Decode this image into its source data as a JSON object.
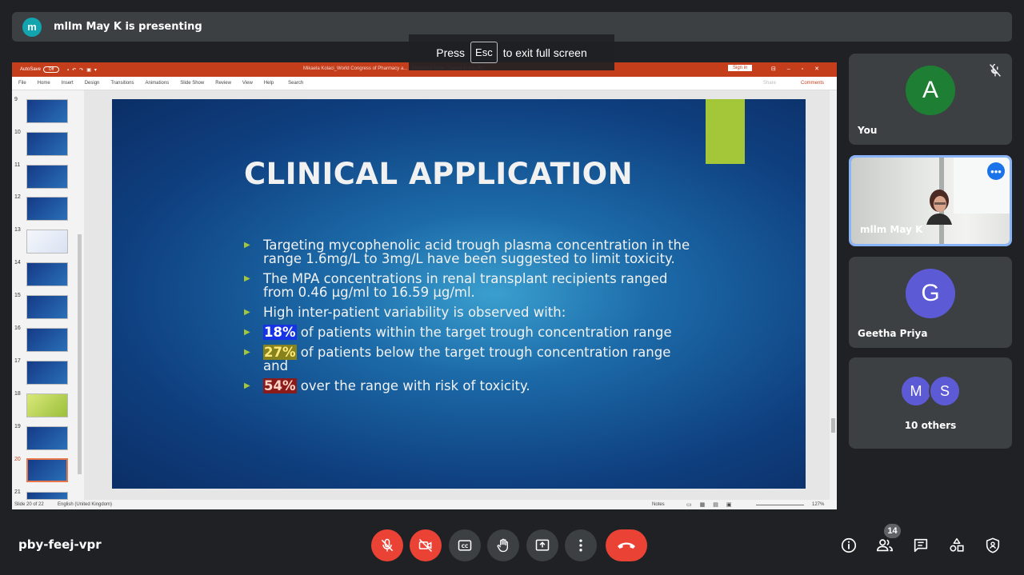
{
  "presenter_banner": {
    "avatar_letter": "m",
    "text": "mllm May K is presenting"
  },
  "fullscreen_toast": {
    "before": "Press",
    "key": "Esc",
    "after": "to exit full screen"
  },
  "ppt": {
    "autosave_label": "AutoSave",
    "autosave_state": "Off",
    "document_title": "Mikaela Kolaci_World Congress of  Pharmacy a...  ·  Protected View  ·  Saved to this PC",
    "signin_label": "Sign in",
    "menu": [
      "File",
      "Home",
      "Insert",
      "Design",
      "Transitions",
      "Animations",
      "Slide Show",
      "Review",
      "View",
      "Help"
    ],
    "search_label": "Search",
    "share_label": "Share",
    "comments_label": "Comments",
    "thumbnail_numbers": [
      "9",
      "10",
      "11",
      "12",
      "13",
      "14",
      "15",
      "16",
      "17",
      "18",
      "19",
      "20",
      "21"
    ],
    "active_slide_number": "20",
    "status": {
      "slide_count": "Slide 20 of 22",
      "language": "English (United Kingdom)",
      "notes": "Notes",
      "zoom": "127%"
    }
  },
  "slide": {
    "title": "CLINICAL APPLICATION",
    "bullets": [
      {
        "text": "Targeting mycophenolic acid trough plasma concentration in the range 1.6mg/L  to 3mg/L have been suggested to limit toxicity."
      },
      {
        "text": "The MPA concentrations in renal transplant recipients ranged from 0.46 µg/ml to 16.59 µg/ml."
      },
      {
        "text": "High inter-patient variability is observed with:"
      },
      {
        "highlight": "18%",
        "text": " of patients within the target trough concentration range"
      },
      {
        "highlight": "27%",
        "text": " of patients below the target trough concentration range and"
      },
      {
        "highlight": "54%",
        "text": " over the range with risk of toxicity."
      }
    ],
    "highlight_colors": {
      "blue": "#1633e6",
      "olive": "#86821d",
      "red": "#8b1a1a"
    },
    "accent_color": "#a4c639"
  },
  "participants": [
    {
      "avatar_letter": "A",
      "name": "You",
      "avatar_color": "#1e7e34",
      "muted": true
    },
    {
      "name": "mllm May K",
      "video": true
    },
    {
      "avatar_letter": "G",
      "name": "Geetha Priya",
      "avatar_color": "#5d5ad6"
    },
    {
      "group_letters": [
        "M",
        "S"
      ],
      "name": "10 others"
    }
  ],
  "bottom_bar": {
    "meeting_code": "pby-feej-vpr",
    "participant_count": "14",
    "controls": [
      "mic-off-icon",
      "camera-off-icon",
      "captions-icon",
      "raise-hand-icon",
      "present-icon",
      "more-options-icon",
      "end-call-icon"
    ],
    "right_icons": [
      "info-icon",
      "people-icon",
      "chat-icon",
      "activities-icon",
      "host-controls-icon"
    ]
  }
}
